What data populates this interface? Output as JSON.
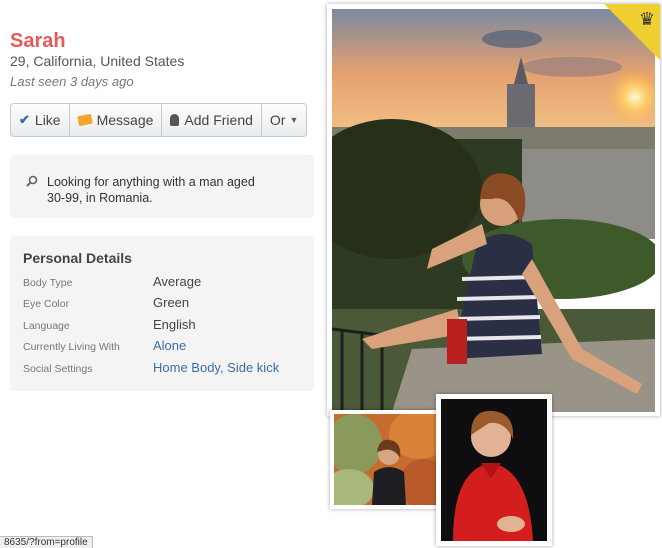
{
  "profile": {
    "name": "Sarah",
    "location": "29, California, United States",
    "last_seen": "Last seen 3 days ago"
  },
  "actions": {
    "like": "Like",
    "message": "Message",
    "add_friend": "Add Friend",
    "more": "Or"
  },
  "looking_for": {
    "text": "Looking for anything with a man aged 30-99, in Romania."
  },
  "details": {
    "title": "Personal Details",
    "rows": [
      {
        "label": "Body Type",
        "value": "Average"
      },
      {
        "label": "Eye Color",
        "value": "Green"
      },
      {
        "label": "Language",
        "value": "English"
      },
      {
        "label": "Currently Living With",
        "value": "Alone"
      },
      {
        "label": "Social Settings",
        "value": "Home Body, Side kick"
      }
    ]
  },
  "status_bar": "8635/?from=profile",
  "colors": {
    "name": "#e8585a",
    "link": "#3a6ea8",
    "crown_badge": "#f0d030",
    "panel_bg": "#f4f4f4"
  },
  "icons": [
    "check-icon",
    "message-icon",
    "add-friend-icon",
    "caret-down-icon",
    "search-icon",
    "crown-icon"
  ]
}
